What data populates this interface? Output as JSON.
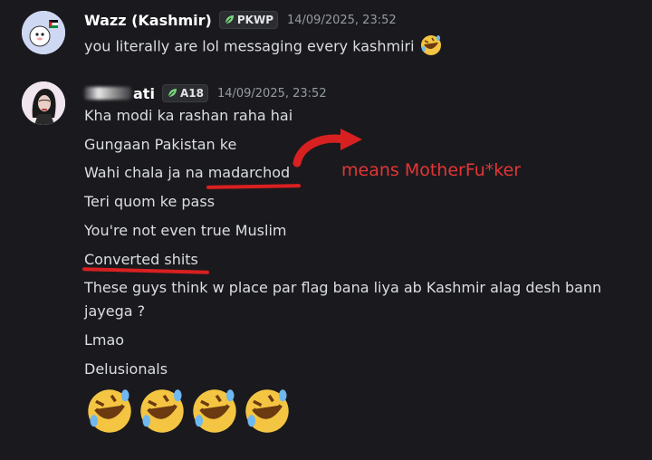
{
  "messages": [
    {
      "author": "Wazz (Kashmir)",
      "tag": "PKWP",
      "timestamp": "14/09/2025, 23:52",
      "lines": [
        "you literally are lol messaging every kashmiri"
      ]
    },
    {
      "author": "ati",
      "tag": "A18",
      "timestamp": "14/09/2025, 23:52",
      "lines": [
        "Kha modi ka rashan raha hai",
        "Gungaan Pakistan ke",
        "Wahi chala ja na ",
        "madarchod",
        "Teri quom ke pass",
        "You're not even true Muslim",
        "Converted shits",
        "These guys think w place par flag bana liya ab Kashmir alag desh bann",
        "jayega ?",
        "Lmao",
        "Delusionals"
      ]
    }
  ],
  "annotation": {
    "text": "means MotherFu*ker",
    "color": "#e53535"
  },
  "colors": {
    "background": "#1a1a1e",
    "text": "#dbdee1",
    "timestamp": "#949ba4",
    "annotation_red": "#d92020"
  },
  "icons": [
    "leaf-icon",
    "rofl-emoji",
    "curved-arrow"
  ]
}
